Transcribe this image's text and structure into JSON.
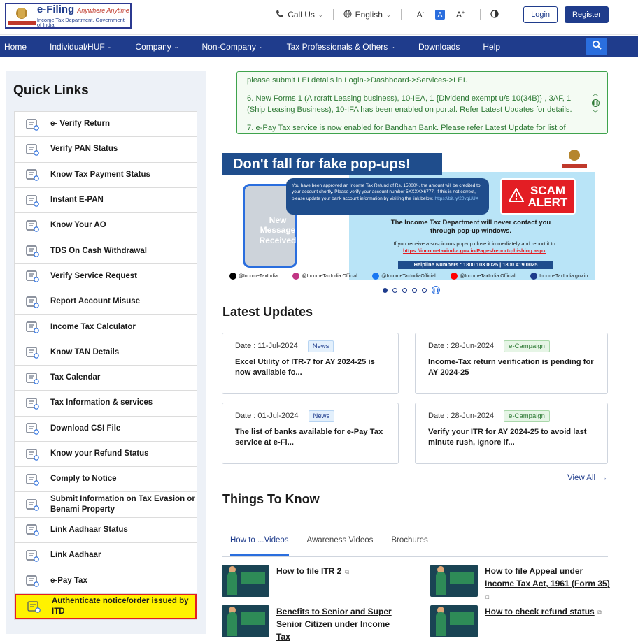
{
  "header": {
    "logo_title": "e-Filing",
    "logo_tagline": "Anywhere Anytime",
    "logo_subtitle": "Income Tax Department, Government of India",
    "call_us": "Call Us",
    "language": "English",
    "font_small": "A",
    "font_default": "A",
    "font_large": "A",
    "login": "Login",
    "register": "Register"
  },
  "nav": {
    "items": [
      {
        "label": "Home",
        "dropdown": false
      },
      {
        "label": "Individual/HUF",
        "dropdown": true
      },
      {
        "label": "Company",
        "dropdown": true
      },
      {
        "label": "Non-Company",
        "dropdown": true
      },
      {
        "label": "Tax Professionals & Others",
        "dropdown": true
      },
      {
        "label": "Downloads",
        "dropdown": false
      },
      {
        "label": "Help",
        "dropdown": false
      }
    ]
  },
  "quick_links": {
    "title": "Quick Links",
    "items": [
      {
        "label": "e- Verify Return",
        "icon": "everify-icon"
      },
      {
        "label": "Verify PAN Status",
        "icon": "pan-card-icon"
      },
      {
        "label": "Know Tax Payment Status",
        "icon": "tax-payment-icon"
      },
      {
        "label": "Instant E-PAN",
        "icon": "epan-icon"
      },
      {
        "label": "Know Your AO",
        "icon": "ao-icon"
      },
      {
        "label": "TDS On Cash Withdrawal",
        "icon": "cash-withdrawal-icon"
      },
      {
        "label": "Verify Service Request",
        "icon": "service-request-icon"
      },
      {
        "label": "Report Account Misuse",
        "icon": "report-misuse-icon"
      },
      {
        "label": "Income Tax Calculator",
        "icon": "calculator-icon"
      },
      {
        "label": "Know TAN Details",
        "icon": "tan-icon"
      },
      {
        "label": "Tax Calendar",
        "icon": "calendar-icon"
      },
      {
        "label": "Tax Information & services",
        "icon": "info-icon"
      },
      {
        "label": "Download CSI File",
        "icon": "csi-file-icon"
      },
      {
        "label": "Know your Refund Status",
        "icon": "refund-icon"
      },
      {
        "label": "Comply to Notice",
        "icon": "notice-icon"
      },
      {
        "label": "Submit Information on Tax Evasion or Benami Property",
        "icon": "tax-evasion-icon"
      },
      {
        "label": "Link Aadhaar Status",
        "icon": "aadhaar-status-icon"
      },
      {
        "label": "Link Aadhaar",
        "icon": "link-aadhaar-icon"
      },
      {
        "label": "e-Pay Tax",
        "icon": "epay-icon"
      },
      {
        "label": "Authenticate notice/order issued by ITD",
        "icon": "authenticate-icon",
        "highlighted": true
      }
    ]
  },
  "ticker": {
    "line1": "please submit LEI details in Login->Dashboard->Services->LEI.",
    "line2": "6. New Forms 1 (Aircraft Leasing business), 10-IEA, 1 {Dividend exempt u/s 10(34B)} , 3AF, 1 (Ship Leasing Business), 10-IFA has been enabled on portal. Refer Latest Updates for details.",
    "line3": "7. e-Pay Tax service is now enabled for Bandhan Bank. Please refer Latest Update for list of"
  },
  "banner": {
    "headline": "Don't fall for fake pop-ups!",
    "phone_text": "New Message Received",
    "bubble_text": "You have been approved an Income Tax Refund of Rs. 15000/-, the amount will be credited to your account shortly. Please verify your account number 5XXXXX6777. If this is not correct, please update your bank account information by visiting the link below.",
    "bubble_link": "https://bit.ly/20vgUUX",
    "scam_line1": "SCAM",
    "scam_line2": "ALERT",
    "message": "The Income Tax Department will never contact you through pop-up windows.",
    "report_text": "If you receive a suspicious pop-up close it immediately and report it to",
    "report_link": "https://incometaxindia.gov.in/Pages/report-phishing.aspx",
    "helpline": "Helpline Numbers : 1800 103 0025 | 1800 419 0025",
    "social": [
      {
        "label": "@IncomeTaxIndia",
        "color": "#000000"
      },
      {
        "label": "@IncomeTaxIndia.Official",
        "color": "#c13584"
      },
      {
        "label": "@IncomeTaxIndiaOfficial",
        "color": "#1877f2"
      },
      {
        "label": "@IncomeTaxIndia.Official",
        "color": "#ff0000"
      },
      {
        "label": "IncomeTaxIndia.gov.in",
        "color": "#1f3c8c"
      }
    ]
  },
  "latest_updates": {
    "title": "Latest Updates",
    "cards": [
      {
        "date": "Date : 11-Jul-2024",
        "badge": "News",
        "type": "news",
        "text": "Excel Utility of ITR-7 for AY 2024-25 is now available fo..."
      },
      {
        "date": "Date : 28-Jun-2024",
        "badge": "e-Campaign",
        "type": "camp",
        "text": "Income-Tax return verification is pending for AY 2024-25"
      },
      {
        "date": "Date : 01-Jul-2024",
        "badge": "News",
        "type": "news",
        "text": "The list of banks available for e-Pay Tax service at e-Fi..."
      },
      {
        "date": "Date : 28-Jun-2024",
        "badge": "e-Campaign",
        "type": "camp",
        "text": "Verify your ITR for AY 2024-25 to avoid last minute rush, Ignore if..."
      }
    ],
    "view_all": "View All"
  },
  "things_to_know": {
    "title": "Things To Know",
    "tabs": [
      "How to ...Videos",
      "Awareness Videos",
      "Brochures"
    ],
    "videos": [
      {
        "title": "How to file ITR 2"
      },
      {
        "title": "How to file Appeal under Income Tax Act, 1961 (Form 35)"
      },
      {
        "title": "Benefits to Senior and Super Senior Citizen under Income Tax"
      },
      {
        "title": "How to check refund status"
      }
    ]
  },
  "colors": {
    "primary": "#1f3c8c",
    "accent": "#2a6ede",
    "ticker_green": "#2f7a36",
    "highlight_yellow": "#fff200",
    "highlight_border": "#e31e24"
  }
}
